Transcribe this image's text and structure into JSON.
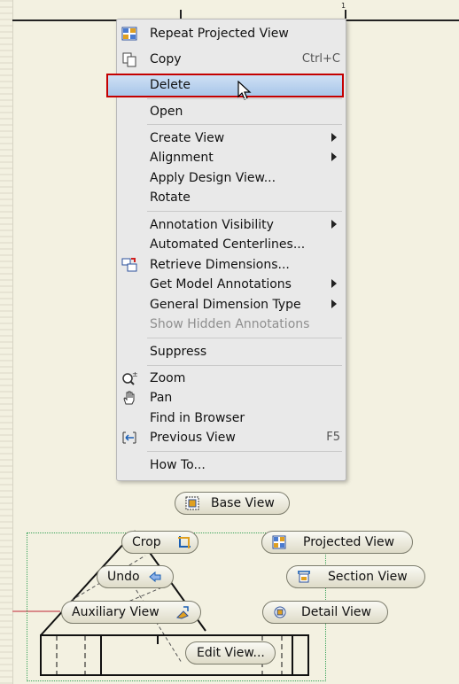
{
  "sheet": {
    "zone_number": "1"
  },
  "context_menu": {
    "items": [
      {
        "label": "Repeat Projected View",
        "icon": "projected-view-icon"
      },
      {
        "label": "Copy",
        "shortcut": "Ctrl+C",
        "icon": "copy-icon"
      },
      {
        "label": "Delete",
        "highlighted": true
      },
      {
        "label": "Open"
      },
      {
        "label": "Create View",
        "submenu": true
      },
      {
        "label": "Alignment",
        "submenu": true
      },
      {
        "label": "Apply Design View..."
      },
      {
        "label": "Rotate"
      },
      {
        "label": "Annotation Visibility",
        "submenu": true
      },
      {
        "label": "Automated Centerlines..."
      },
      {
        "label": "Retrieve Dimensions...",
        "icon": "retrieve-dimensions-icon"
      },
      {
        "label": "Get Model Annotations",
        "submenu": true
      },
      {
        "label": "General Dimension Type",
        "submenu": true
      },
      {
        "label": "Show Hidden Annotations",
        "disabled": true
      },
      {
        "label": "Suppress"
      },
      {
        "label": "Zoom",
        "icon": "zoom-icon"
      },
      {
        "label": "Pan",
        "icon": "pan-hand-icon"
      },
      {
        "label": "Find in Browser"
      },
      {
        "label": "Previous View",
        "shortcut": "F5",
        "icon": "previous-view-icon"
      },
      {
        "label": "How To..."
      }
    ]
  },
  "marking_menu": {
    "base_view": "Base View",
    "crop": "Crop",
    "projected_view": "Projected View",
    "undo": "Undo",
    "section_view": "Section View",
    "auxiliary_view": "Auxiliary View",
    "detail_view": "Detail View",
    "edit_view": "Edit View..."
  },
  "colors": {
    "highlight_border": "#c40000",
    "highlight_fill": "#b8d2ee",
    "sheet": "#f3f1e1"
  }
}
